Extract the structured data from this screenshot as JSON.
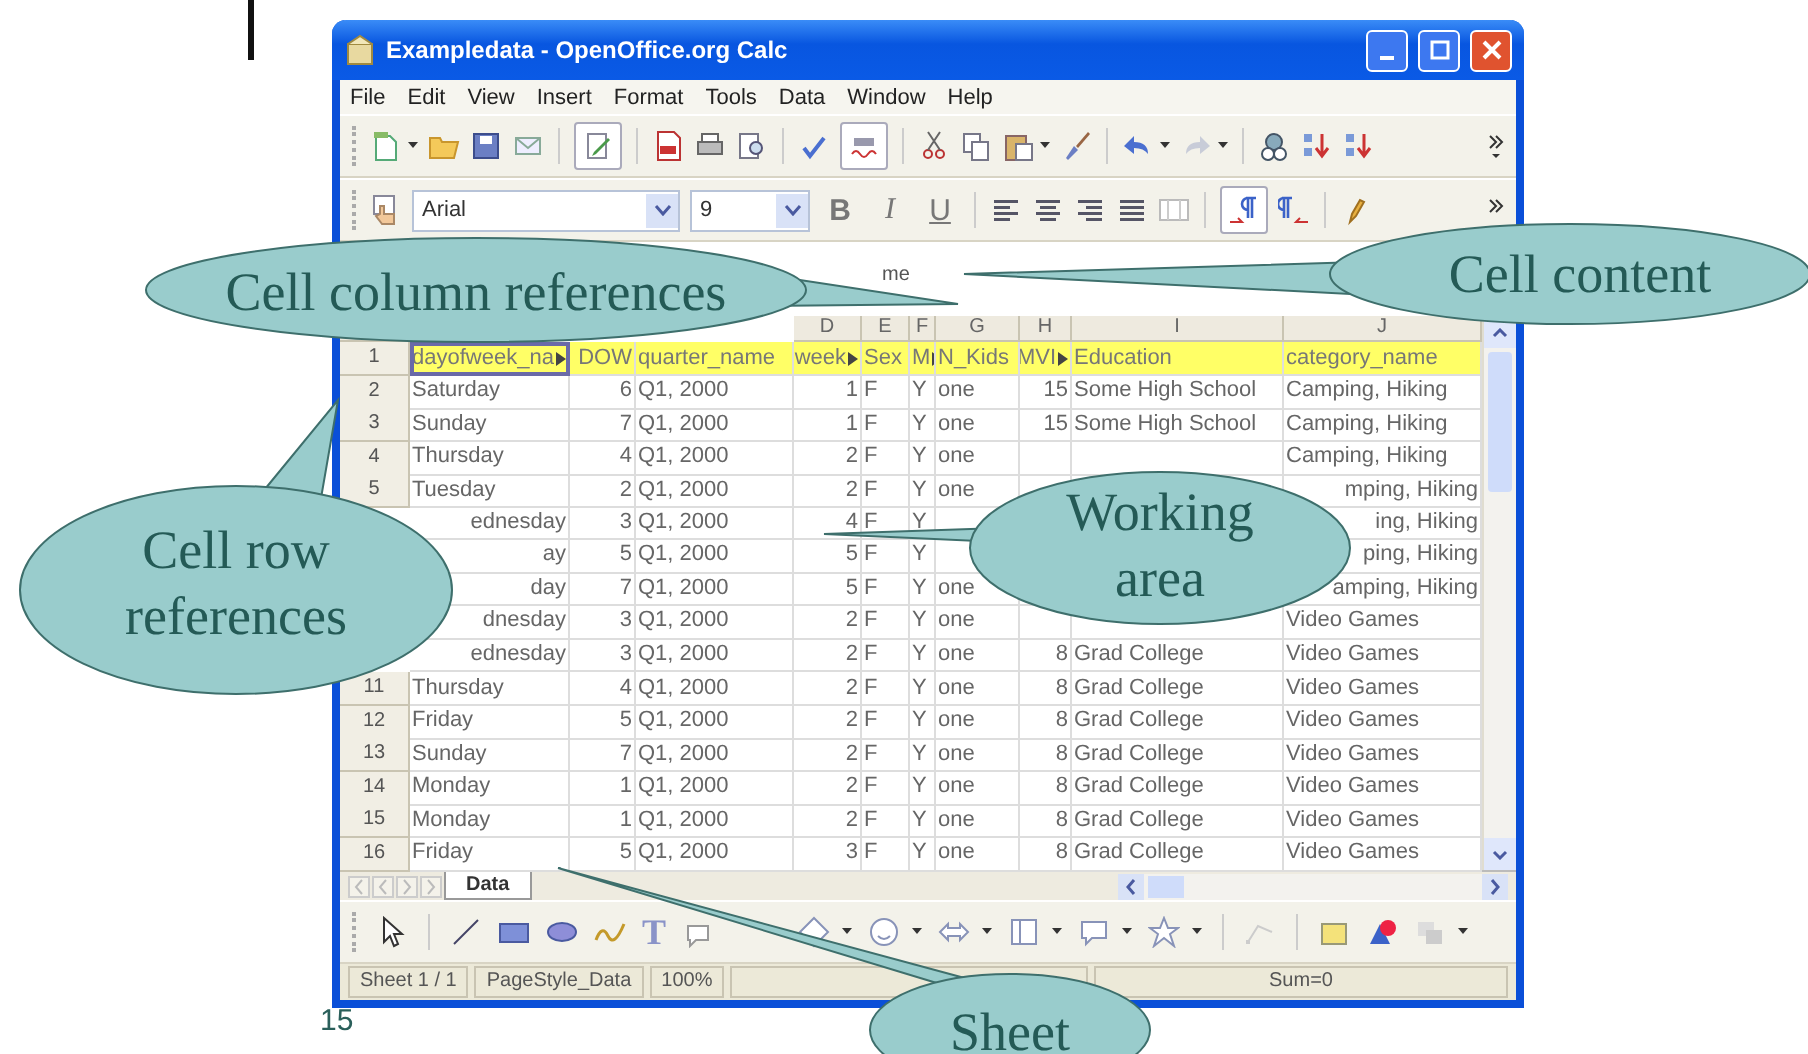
{
  "slide": {
    "number": "15"
  },
  "window": {
    "title": "Exampledata - OpenOffice.org Calc"
  },
  "menu": [
    "File",
    "Edit",
    "View",
    "Insert",
    "Format",
    "Tools",
    "Data",
    "Window",
    "Help"
  ],
  "formatting": {
    "font": "Arial",
    "size": "9",
    "buttons": [
      "B",
      "I",
      "U"
    ]
  },
  "formula_bar": {
    "content": "me"
  },
  "columns": [
    null,
    null,
    null,
    "D",
    "E",
    "F",
    "G",
    "H",
    "I",
    "J"
  ],
  "rows": [
    {
      "number": "1",
      "highlighted": true,
      "selected": true,
      "cells": [
        {
          "text": "dayofweek_na",
          "clipped": true
        },
        "DOW",
        "quarter_name",
        {
          "text": "week",
          "clipped": true
        },
        "Sex",
        {
          "text": "M",
          "clipped": true
        },
        "N_Kids",
        {
          "text": "MVI",
          "clipped": true
        },
        "Education",
        "category_name"
      ]
    },
    {
      "number": "2",
      "highlighted": false,
      "selected": false,
      "cells": [
        "Saturday",
        "6",
        "Q1, 2000",
        "1",
        "F",
        "Y",
        "one",
        "15",
        "Some High School",
        "Camping, Hiking"
      ]
    },
    {
      "number": "3",
      "highlighted": false,
      "selected": false,
      "cells": [
        "Sunday",
        "7",
        "Q1, 2000",
        "1",
        "F",
        "Y",
        "one",
        "15",
        "Some High School",
        "Camping, Hiking"
      ]
    },
    {
      "number": "4",
      "highlighted": false,
      "selected": false,
      "cells": [
        "Thursday",
        "4",
        "Q1, 2000",
        "2",
        "F",
        "Y",
        "one",
        null,
        null,
        "Camping, Hiking"
      ]
    },
    {
      "number": "5",
      "highlighted": false,
      "selected": false,
      "cells": [
        "Tuesday",
        "2",
        "Q1, 2000",
        "2",
        "F",
        "Y",
        "one",
        null,
        null,
        {
          "text": "mping, Hiking",
          "cut": true
        }
      ]
    },
    {
      "number": null,
      "highlighted": false,
      "selected": false,
      "cells": [
        {
          "text": "ednesday",
          "cut": true
        },
        "3",
        "Q1, 2000",
        "4",
        "F",
        "Y",
        null,
        null,
        null,
        {
          "text": "ing, Hiking",
          "cut": true
        }
      ]
    },
    {
      "number": null,
      "highlighted": false,
      "selected": false,
      "cells": [
        {
          "text": "ay",
          "cut": true
        },
        "5",
        "Q1, 2000",
        "5",
        "F",
        "Y",
        null,
        null,
        null,
        {
          "text": "ping, Hiking",
          "cut": true
        }
      ]
    },
    {
      "number": null,
      "highlighted": false,
      "selected": false,
      "cells": [
        {
          "text": "day",
          "cut": true
        },
        "7",
        "Q1, 2000",
        "5",
        "F",
        "Y",
        "one",
        null,
        null,
        {
          "text": "amping, Hiking",
          "cut": true
        }
      ]
    },
    {
      "number": null,
      "highlighted": false,
      "selected": false,
      "cells": [
        {
          "text": "dnesday",
          "cut": true
        },
        "3",
        "Q1, 2000",
        "2",
        "F",
        "Y",
        "one",
        null,
        null,
        "Video Games"
      ]
    },
    {
      "number": null,
      "highlighted": false,
      "selected": false,
      "cells": [
        {
          "text": "ednesday",
          "cut": true
        },
        "3",
        "Q1, 2000",
        "2",
        "F",
        "Y",
        "one",
        "8",
        "Grad College",
        "Video Games"
      ]
    },
    {
      "number": "11",
      "highlighted": false,
      "selected": false,
      "cells": [
        "Thursday",
        "4",
        "Q1, 2000",
        "2",
        "F",
        "Y",
        "one",
        "8",
        "Grad College",
        "Video Games"
      ]
    },
    {
      "number": "12",
      "highlighted": false,
      "selected": false,
      "cells": [
        "Friday",
        "5",
        "Q1, 2000",
        "2",
        "F",
        "Y",
        "one",
        "8",
        "Grad College",
        "Video Games"
      ]
    },
    {
      "number": "13",
      "highlighted": false,
      "selected": false,
      "cells": [
        "Sunday",
        "7",
        "Q1, 2000",
        "2",
        "F",
        "Y",
        "one",
        "8",
        "Grad College",
        "Video Games"
      ]
    },
    {
      "number": "14",
      "highlighted": false,
      "selected": false,
      "cells": [
        "Monday",
        "1",
        "Q1, 2000",
        "2",
        "F",
        "Y",
        "one",
        "8",
        "Grad College",
        "Video Games"
      ]
    },
    {
      "number": "15",
      "highlighted": false,
      "selected": false,
      "cells": [
        "Monday",
        "1",
        "Q1, 2000",
        "2",
        "F",
        "Y",
        "one",
        "8",
        "Grad College",
        "Video Games"
      ]
    },
    {
      "number": "16",
      "highlighted": false,
      "selected": false,
      "cells": [
        "Friday",
        "5",
        "Q1, 2000",
        "3",
        "F",
        "Y",
        "one",
        "8",
        "Grad College",
        "Video Games"
      ]
    }
  ],
  "sheet_tabs": [
    {
      "label": "Data",
      "selected": true
    }
  ],
  "drawing_toolbar": {
    "text_tool": "T"
  },
  "status_bar": {
    "fields": [
      "Sheet 1 / 1",
      "PageStyle_Data",
      "100%"
    ],
    "sum": "Sum=0"
  },
  "callouts": [
    {
      "lines": [
        "Cell column references"
      ]
    },
    {
      "lines": [
        "Cell content"
      ]
    },
    {
      "lines": [
        "Cell row",
        "references"
      ]
    },
    {
      "lines": [
        "Working",
        "area"
      ]
    },
    {
      "lines": [
        "Sheet"
      ]
    }
  ]
}
